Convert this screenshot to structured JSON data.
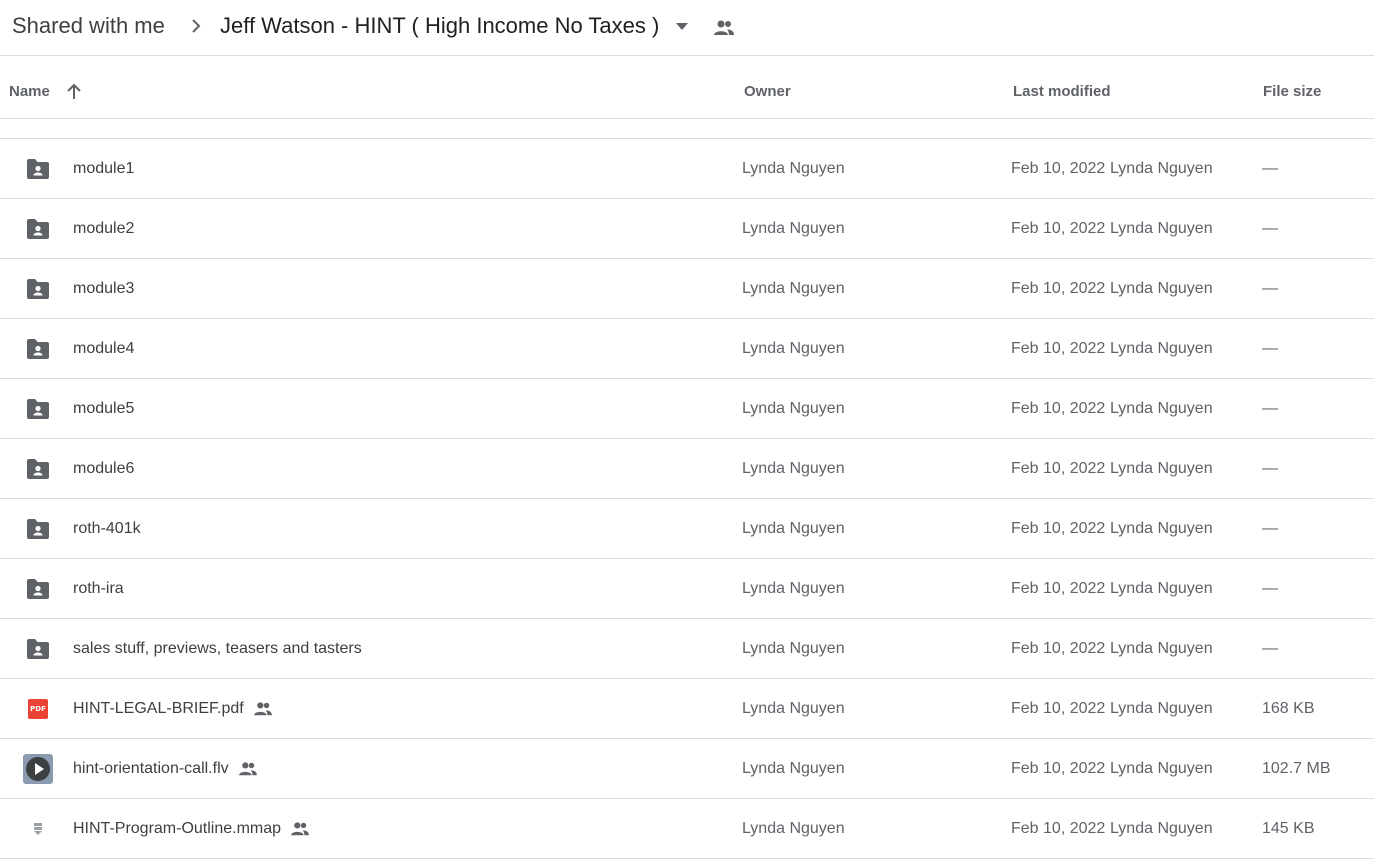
{
  "breadcrumb": {
    "root": "Shared with me",
    "current": "Jeff Watson - HINT ( High Income No Taxes )"
  },
  "columns": {
    "name": "Name",
    "owner": "Owner",
    "last_modified": "Last modified",
    "file_size": "File size"
  },
  "files": [
    {
      "name": "module1",
      "type": "shared-folder",
      "owner": "Lynda Nguyen",
      "date": "Feb 10, 2022",
      "modified_by": "Lynda Nguyen",
      "size": "—",
      "shared": false
    },
    {
      "name": "module2",
      "type": "shared-folder",
      "owner": "Lynda Nguyen",
      "date": "Feb 10, 2022",
      "modified_by": "Lynda Nguyen",
      "size": "—",
      "shared": false
    },
    {
      "name": "module3",
      "type": "shared-folder",
      "owner": "Lynda Nguyen",
      "date": "Feb 10, 2022",
      "modified_by": "Lynda Nguyen",
      "size": "—",
      "shared": false
    },
    {
      "name": "module4",
      "type": "shared-folder",
      "owner": "Lynda Nguyen",
      "date": "Feb 10, 2022",
      "modified_by": "Lynda Nguyen",
      "size": "—",
      "shared": false
    },
    {
      "name": "module5",
      "type": "shared-folder",
      "owner": "Lynda Nguyen",
      "date": "Feb 10, 2022",
      "modified_by": "Lynda Nguyen",
      "size": "—",
      "shared": false
    },
    {
      "name": "module6",
      "type": "shared-folder",
      "owner": "Lynda Nguyen",
      "date": "Feb 10, 2022",
      "modified_by": "Lynda Nguyen",
      "size": "—",
      "shared": false
    },
    {
      "name": "roth-401k",
      "type": "shared-folder",
      "owner": "Lynda Nguyen",
      "date": "Feb 10, 2022",
      "modified_by": "Lynda Nguyen",
      "size": "—",
      "shared": false
    },
    {
      "name": "roth-ira",
      "type": "shared-folder",
      "owner": "Lynda Nguyen",
      "date": "Feb 10, 2022",
      "modified_by": "Lynda Nguyen",
      "size": "—",
      "shared": false
    },
    {
      "name": "sales stuff, previews, teasers and tasters",
      "type": "shared-folder",
      "owner": "Lynda Nguyen",
      "date": "Feb 10, 2022",
      "modified_by": "Lynda Nguyen",
      "size": "—",
      "shared": false
    },
    {
      "name": "HINT-LEGAL-BRIEF.pdf",
      "type": "pdf",
      "icon_text": "PDF",
      "owner": "Lynda Nguyen",
      "date": "Feb 10, 2022",
      "modified_by": "Lynda Nguyen",
      "size": "168 KB",
      "shared": true
    },
    {
      "name": "hint-orientation-call.flv",
      "type": "video",
      "owner": "Lynda Nguyen",
      "date": "Feb 10, 2022",
      "modified_by": "Lynda Nguyen",
      "size": "102.7 MB",
      "shared": true
    },
    {
      "name": "HINT-Program-Outline.mmap",
      "type": "generic",
      "owner": "Lynda Nguyen",
      "date": "Feb 10, 2022",
      "modified_by": "Lynda Nguyen",
      "size": "145 KB",
      "shared": true
    }
  ],
  "icons": {
    "breadcrumb_separator": "chevron-right-icon",
    "dropdown": "caret-down-icon",
    "shared": "people-icon",
    "sort": "arrow-up-icon",
    "folder": "shared-folder-icon",
    "pdf": "pdf-icon",
    "video": "video-icon",
    "generic": "file-icon"
  },
  "colors": {
    "icon_gray": "#5f6368",
    "pdf_red": "#ea4335",
    "divider": "#dadce0"
  }
}
